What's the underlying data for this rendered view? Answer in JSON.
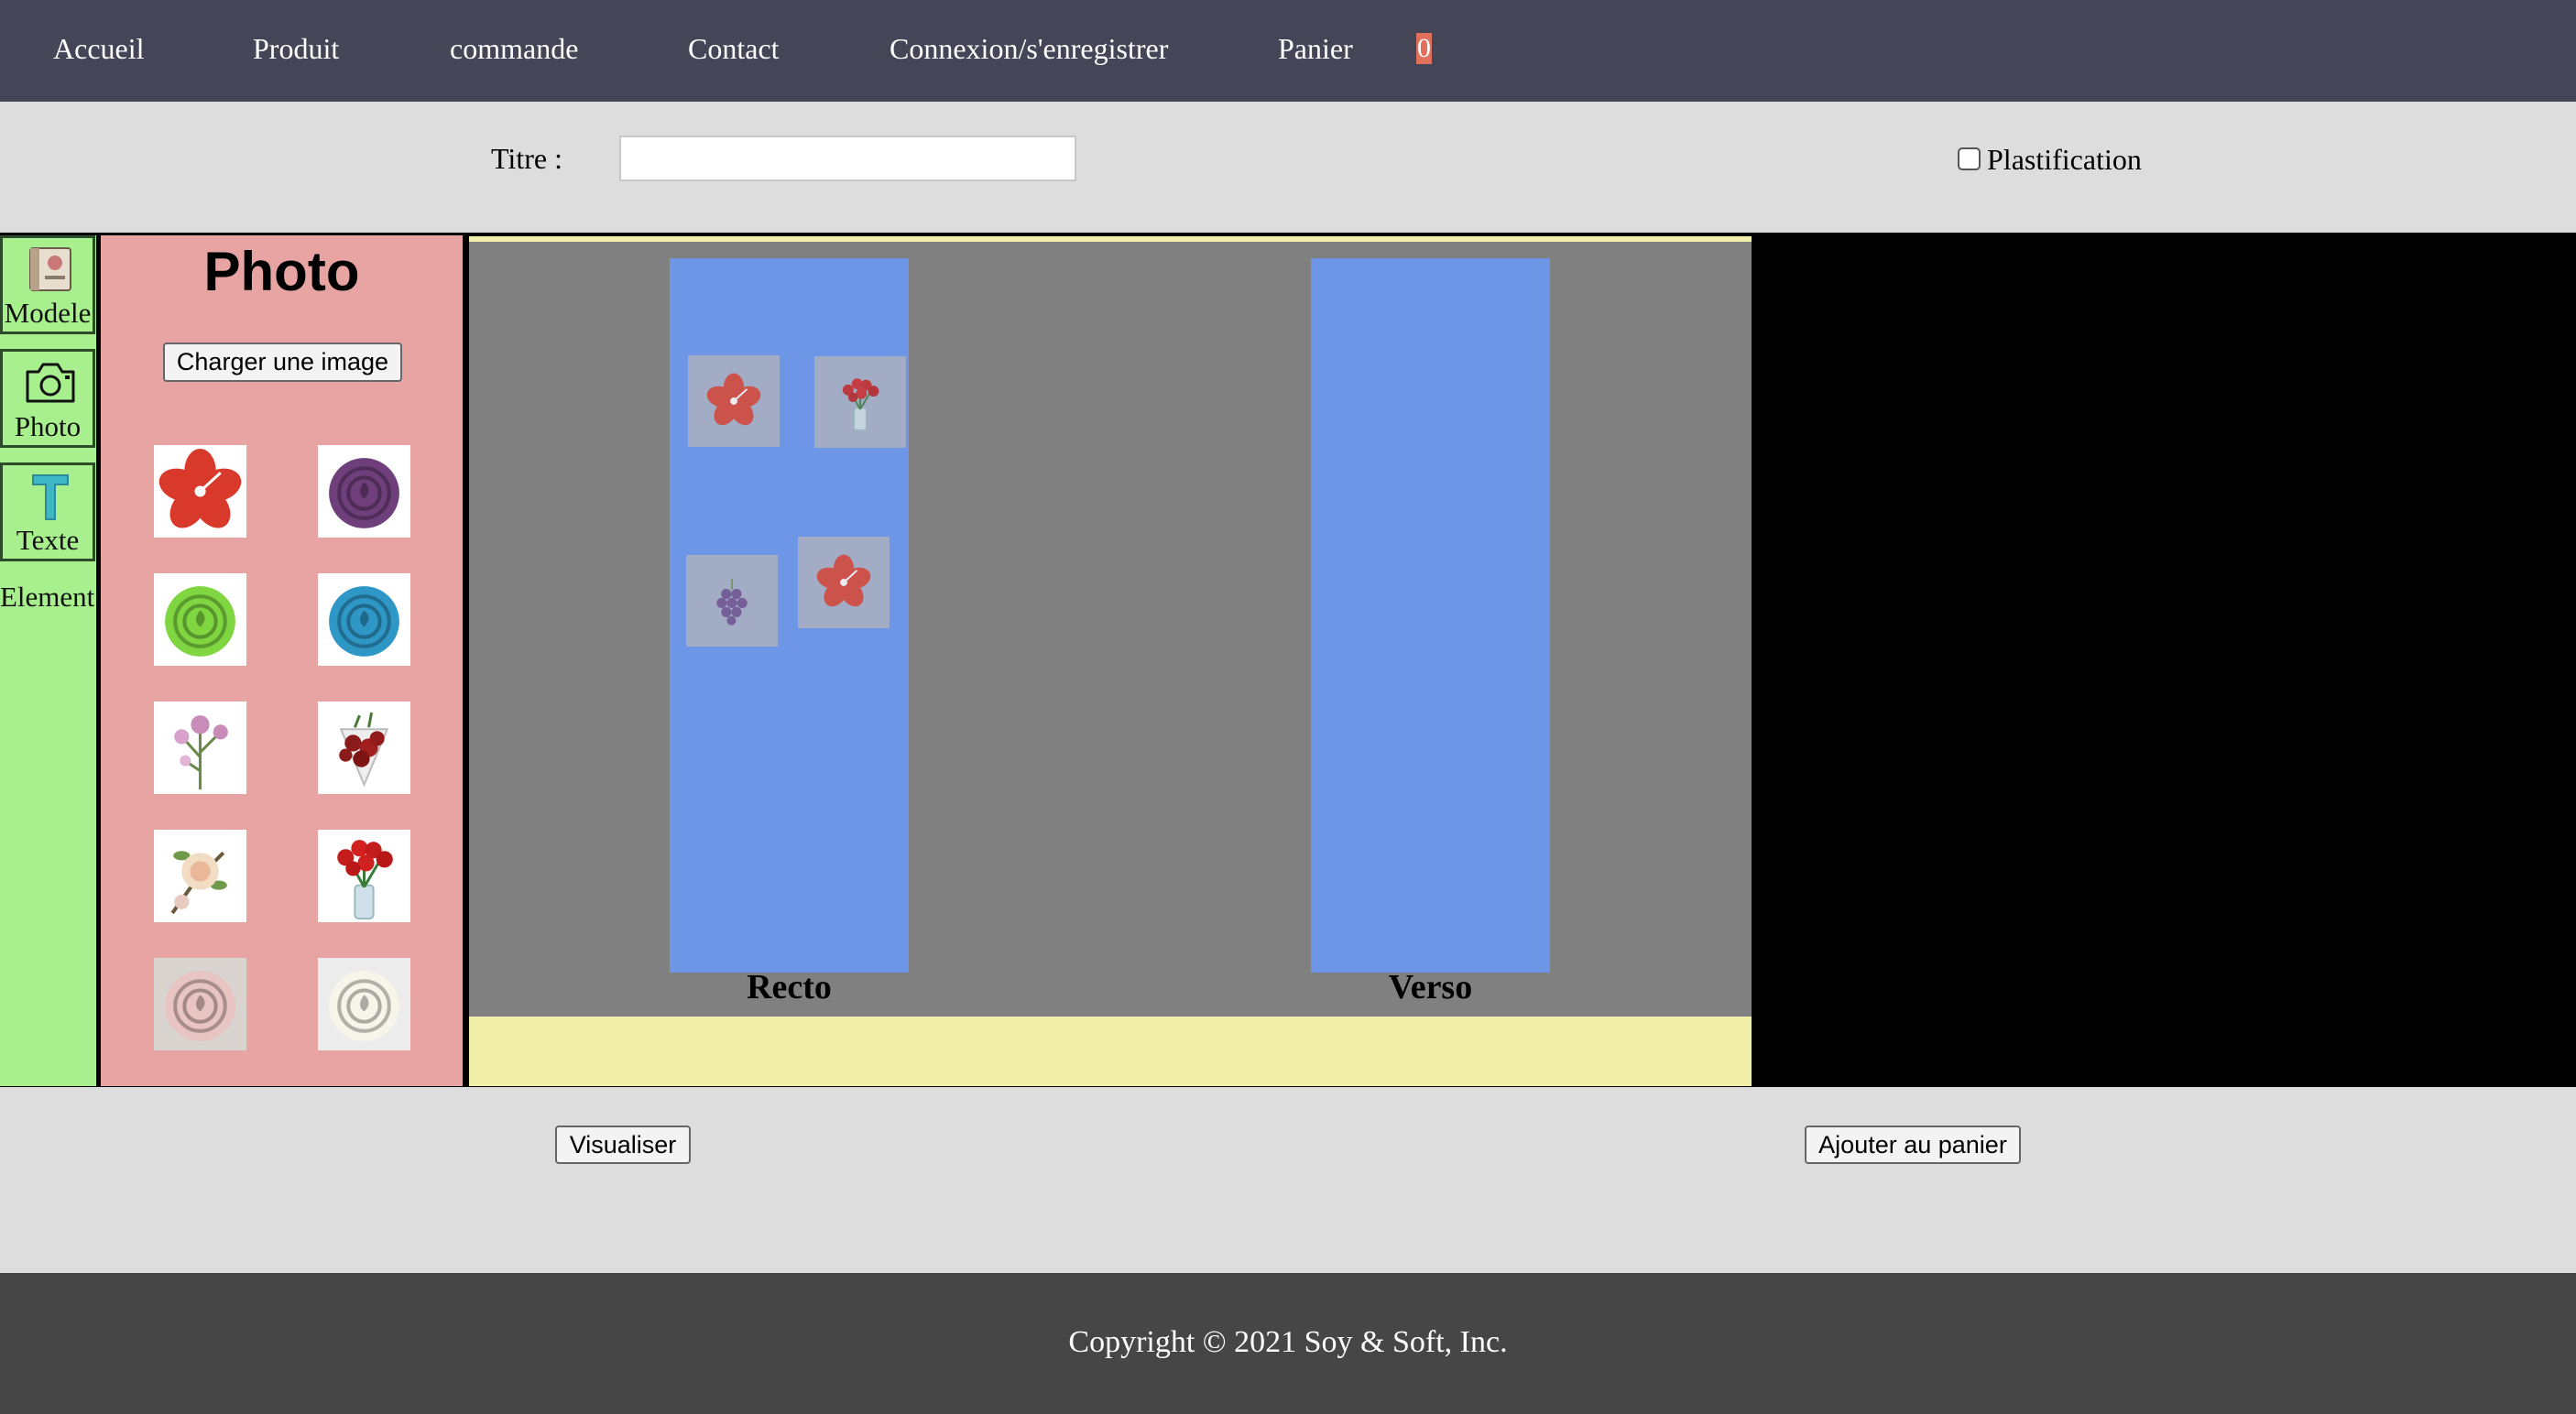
{
  "nav": {
    "items": [
      "Accueil",
      "Produit",
      "commande",
      "Contact",
      "Connexion/s'enregistrer",
      "Panier"
    ],
    "cart_count": "0"
  },
  "form": {
    "title_label": "Titre :",
    "title_value": "",
    "plastification_label": "Plastification",
    "plastification_checked": false
  },
  "toolbar": {
    "items": [
      "Modele",
      "Photo",
      "Texte",
      "Element"
    ],
    "icons": [
      "book-icon",
      "camera-icon",
      "text-icon"
    ]
  },
  "photo_panel": {
    "title": "Photo",
    "upload_label": "Charger une image",
    "thumbnails": [
      "red-hibiscus",
      "purple-rose",
      "green-rose",
      "blue-rose",
      "pink-wildflower",
      "red-rose-bouquet",
      "cream-rose-branch",
      "red-roses-vase",
      "pale-pink-rose",
      "white-rose"
    ]
  },
  "canvas": {
    "recto_label": "Recto",
    "verso_label": "Verso",
    "recto_images": [
      "red-hibiscus",
      "red-roses-vase",
      "purple-grapes-flower",
      "red-hibiscus"
    ]
  },
  "actions": {
    "preview_label": "Visualiser",
    "add_to_cart_label": "Ajouter au panier"
  },
  "footer": {
    "copyright": "Copyright © 2021 Soy & Soft, Inc."
  },
  "colors": {
    "nav_bg": "#444657",
    "toolbar_bg": "#a8ef8e",
    "panel_bg": "#e8a4a2",
    "canvas_bg": "#808080",
    "card_bg": "#6d96e6",
    "canvas_footer_bg": "#f2efaa",
    "footer_bg": "#464646",
    "badge_bg": "#e0705b"
  }
}
